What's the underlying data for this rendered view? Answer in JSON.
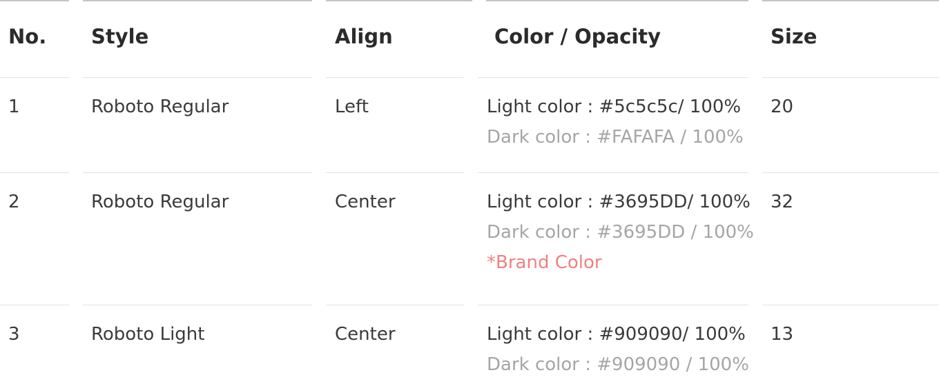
{
  "table": {
    "headers": {
      "no": "No.",
      "style": "Style",
      "align": "Align",
      "color": "Color / Opacity",
      "size": "Size"
    },
    "rows": [
      {
        "no": "1",
        "style": "Roboto Regular",
        "align": "Left",
        "light": "Light color : #5c5c5c/ 100%",
        "dark": "Dark color : #FAFAFA / 100%",
        "note": "",
        "size": "20"
      },
      {
        "no": "2",
        "style": "Roboto Regular",
        "align": "Center",
        "light": "Light color : #3695DD/ 100%",
        "dark": "Dark color  : #3695DD / 100%",
        "note": "*Brand Color",
        "size": "32"
      },
      {
        "no": "3",
        "style": "Roboto Light",
        "align": "Center",
        "light": "Light color  : #909090/ 100%",
        "dark": "Dark color : #909090 / 100%",
        "note": "",
        "size": "13"
      }
    ]
  },
  "colors": {
    "header_text": "#2b2b2b",
    "body_text": "#3a3a3a",
    "dark_text": "#a5a5a5",
    "brand_note": "#f08080",
    "top_border": "#c4c4c4",
    "row_border": "#e3e3e3"
  }
}
